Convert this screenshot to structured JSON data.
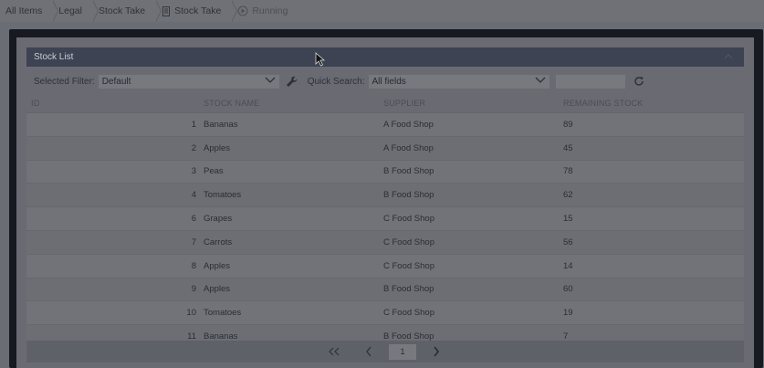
{
  "breadcrumb": [
    {
      "label": "All Items"
    },
    {
      "label": "Legal"
    },
    {
      "label": "Stock Take"
    },
    {
      "label": "Stock Take"
    },
    {
      "label": "Running"
    }
  ],
  "panel": {
    "title": "Stock List"
  },
  "filters": {
    "selected_filter_label": "Selected Filter:",
    "selected_filter_value": "Default",
    "quick_search_label": "Quick Search:",
    "quick_search_field": "All fields",
    "search_value": ""
  },
  "table": {
    "headers": [
      "ID",
      "STOCK NAME",
      "SUPPLIER",
      "REMAINING STOCK"
    ],
    "rows": [
      {
        "id": "1",
        "name": "Bananas",
        "supplier": "A Food Shop",
        "remaining": "89"
      },
      {
        "id": "2",
        "name": "Apples",
        "supplier": "A Food Shop",
        "remaining": "45"
      },
      {
        "id": "3",
        "name": "Peas",
        "supplier": "B Food Shop",
        "remaining": "78"
      },
      {
        "id": "4",
        "name": "Tomatoes",
        "supplier": "B Food Shop",
        "remaining": "62"
      },
      {
        "id": "6",
        "name": "Grapes",
        "supplier": "C Food Shop",
        "remaining": "15"
      },
      {
        "id": "7",
        "name": "Carrots",
        "supplier": "C Food Shop",
        "remaining": "56"
      },
      {
        "id": "8",
        "name": "Apples",
        "supplier": "C Food Shop",
        "remaining": "14"
      },
      {
        "id": "9",
        "name": "Apples",
        "supplier": "B Food Shop",
        "remaining": "60"
      },
      {
        "id": "10",
        "name": "Tomatoes",
        "supplier": "C Food Shop",
        "remaining": "19"
      },
      {
        "id": "11",
        "name": "Bananas",
        "supplier": "B Food Shop",
        "remaining": "7"
      }
    ]
  },
  "pager": {
    "page": "1"
  },
  "icons": {
    "first": "double-chevron-left-icon",
    "prev": "chevron-left-icon",
    "next": "chevron-right-icon",
    "refresh": "refresh-icon",
    "wrench": "wrench-icon",
    "document": "document-icon",
    "play": "play-circle-icon"
  },
  "colors": {
    "header_bg": "#3d4352",
    "frame": "#171a20",
    "overlay": "#6b6d74"
  }
}
